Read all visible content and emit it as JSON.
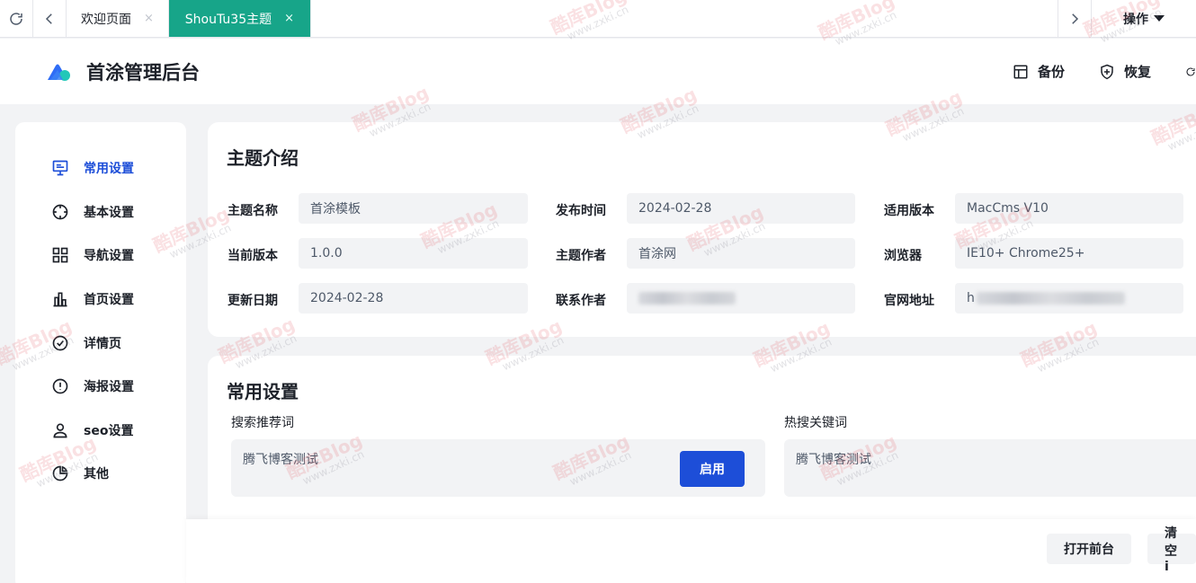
{
  "tabbar": {
    "tabs": [
      {
        "label": "欢迎页面",
        "close": "×"
      },
      {
        "label": "ShouTu35主题",
        "close": "×"
      }
    ],
    "ops_label": "操作"
  },
  "header": {
    "brand": "首涂管理后台",
    "actions": [
      {
        "label": "备份",
        "icon": "layout-icon"
      },
      {
        "label": "恢复",
        "icon": "shield-icon"
      }
    ]
  },
  "sidebar": {
    "items": [
      {
        "label": "常用设置",
        "icon": "monitor-icon",
        "active": true
      },
      {
        "label": "基本设置",
        "icon": "crosshair-icon"
      },
      {
        "label": "导航设置",
        "icon": "grid-icon"
      },
      {
        "label": "首页设置",
        "icon": "bar-chart-icon"
      },
      {
        "label": "详情页",
        "icon": "check-circle-icon"
      },
      {
        "label": "海报设置",
        "icon": "info-circle-icon"
      },
      {
        "label": "seo设置",
        "icon": "user-icon"
      },
      {
        "label": "其他",
        "icon": "pie-icon"
      }
    ]
  },
  "intro": {
    "title": "主题介绍",
    "fields": [
      {
        "label": "主题名称",
        "value": "首涂模板"
      },
      {
        "label": "发布时间",
        "value": "2024-02-28"
      },
      {
        "label": "适用版本",
        "value": "MacCms V10"
      },
      {
        "label": "当前版本",
        "value": "1.0.0"
      },
      {
        "label": "主题作者",
        "value": "首涂网"
      },
      {
        "label": "浏览器",
        "value": "IE10+ Chrome25+"
      },
      {
        "label": "更新日期",
        "value": "2024-02-28"
      },
      {
        "label": "联系作者",
        "value": ""
      },
      {
        "label": "官网地址",
        "value": "h"
      }
    ]
  },
  "common": {
    "title": "常用设置",
    "search_label": "搜索推荐词",
    "search_value": "腾飞博客测试",
    "enable_button": "启用",
    "hot_label": "热搜关键词",
    "hot_value": "腾飞博客测试"
  },
  "footer": {
    "open_front": "打开前台",
    "clear": "清空i"
  },
  "watermark": {
    "text": "酷库Blog",
    "url": "www.zxki.cn"
  },
  "colors": {
    "accent_tab": "#17a589",
    "primary": "#1d4ed8"
  }
}
